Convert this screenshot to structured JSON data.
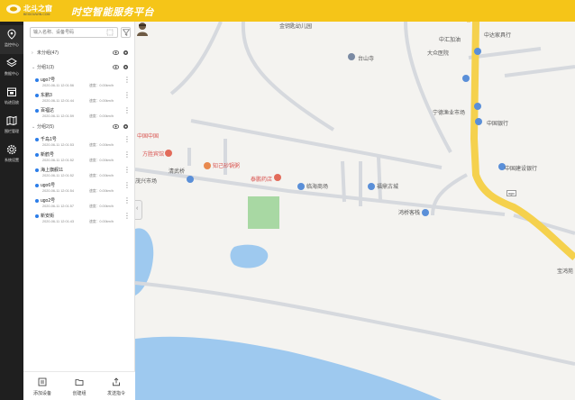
{
  "header": {
    "logo_text": "北斗之窗",
    "logo_sub": "BEIDOUWIN.COM",
    "title": "时空智能服务平台"
  },
  "sidebar": {
    "items": [
      {
        "label": "监控中心",
        "icon": "location-pin-icon"
      },
      {
        "label": "数据中心",
        "icon": "layers-icon"
      },
      {
        "label": "轨迹回放",
        "icon": "calendar-icon"
      },
      {
        "label": "围栏管理",
        "icon": "map-icon"
      },
      {
        "label": "系统设置",
        "icon": "gear-icon"
      }
    ]
  },
  "panel": {
    "search_placeholder": "输入名称、设备号码",
    "groups": [
      {
        "name": "未分组(47)",
        "expanded": false,
        "vehicles": []
      },
      {
        "name": "分组1(3)",
        "expanded": true,
        "vehicles": [
          {
            "name": "ugo7号",
            "time": "2020-06-11 12:01:56",
            "speed": "速度：0.00km/h"
          },
          {
            "name": "东鹏3",
            "time": "2020-06-11 12:01:44",
            "speed": "速度：0.00km/h"
          },
          {
            "name": "百福达",
            "time": "2020-06-11 12:01:59",
            "speed": "速度：0.00km/h"
          }
        ]
      },
      {
        "name": "分组2(5)",
        "expanded": true,
        "vehicles": [
          {
            "name": "千岛1号",
            "time": "2020-06-11 12:01:53",
            "speed": "速度：0.00km/h"
          },
          {
            "name": "新鹤号",
            "time": "2020-06-11 12:01:52",
            "speed": "速度：0.00km/h"
          },
          {
            "name": "海上旗舰11",
            "time": "2020-06-11 12:01:52",
            "speed": "速度：0.00km/h"
          },
          {
            "name": "ugo6号",
            "time": "2020-06-11 12:01:54",
            "speed": "速度：0.00km/h"
          },
          {
            "name": "ugo2号",
            "time": "2020-06-11 12:01:57",
            "speed": "速度：0.00km/h"
          },
          {
            "name": "新安街",
            "time": "2020-06-11 12:01:43",
            "speed": "速度：0.00km/h"
          }
        ]
      }
    ],
    "bottom_actions": [
      {
        "label": "添加设备",
        "icon": "add-device-icon"
      },
      {
        "label": "创建组",
        "icon": "folder-icon"
      },
      {
        "label": "发送指令",
        "icon": "send-icon"
      }
    ]
  },
  "map": {
    "car_tag": "ugo",
    "labels": [
      {
        "text": "中汇加油",
        "color": "normal"
      },
      {
        "text": "中达家具行",
        "color": "normal"
      },
      {
        "text": "大众医院",
        "color": "normal"
      },
      {
        "text": "宁德渔业市场",
        "color": "normal"
      },
      {
        "text": "中国银行",
        "color": "normal"
      },
      {
        "text": "中国建设银行",
        "color": "normal"
      },
      {
        "text": "中国中国",
        "color": "red"
      },
      {
        "text": "方胜宾馆",
        "color": "red"
      },
      {
        "text": "知己砂锅粥",
        "color": "red"
      },
      {
        "text": "泰鹏药店",
        "color": "red"
      },
      {
        "text": "清武桥",
        "color": "normal"
      },
      {
        "text": "茂兴市场",
        "color": "normal"
      },
      {
        "text": "临海商场",
        "color": "normal"
      },
      {
        "text": "福鼎古城",
        "color": "normal"
      },
      {
        "text": "鸿桥客栈",
        "color": "normal"
      },
      {
        "text": "台山寺",
        "color": "normal"
      },
      {
        "text": "金钥匙幼儿园",
        "color": "normal"
      },
      {
        "text": "宝鸿苑",
        "color": "normal"
      }
    ]
  },
  "colors": {
    "header_bg": "#f5c518",
    "sidebar_bg": "#1f1f1f",
    "accent": "#2b7de9"
  }
}
